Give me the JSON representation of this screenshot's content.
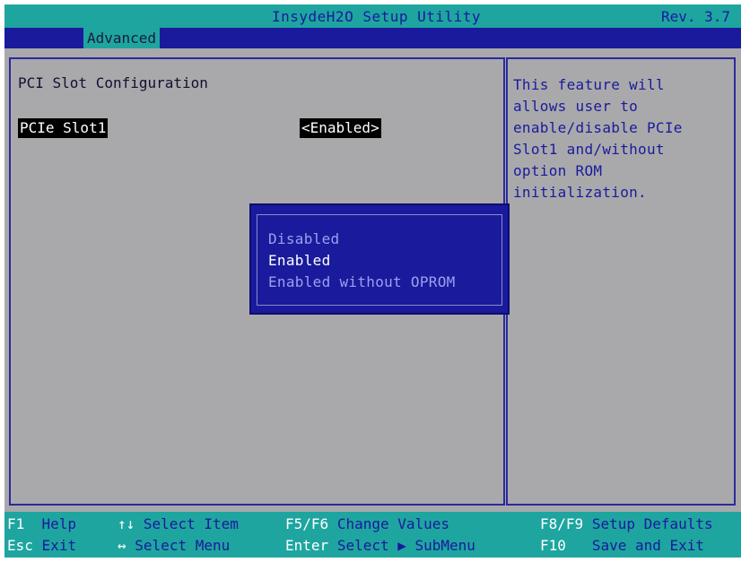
{
  "header": {
    "title": "InsydeH2O Setup Utility",
    "revision": "Rev. 3.7"
  },
  "menu": {
    "active_tab": "Advanced"
  },
  "main": {
    "section_title": "PCI Slot Configuration",
    "setting": {
      "label": "PCIe Slot1",
      "value": "<Enabled>"
    }
  },
  "help": {
    "lines": [
      "This feature will",
      "allows user to",
      "enable/disable PCIe",
      "Slot1 and/without",
      "option ROM",
      "initialization."
    ]
  },
  "popup": {
    "options": [
      "Disabled",
      "Enabled",
      "Enabled without OPROM"
    ],
    "selected": "Enabled"
  },
  "footer": {
    "f1_key": "F1",
    "f1_desc": "Help",
    "esc_key": "Esc",
    "esc_desc": "Exit",
    "updown_key": "↑↓",
    "updown_desc": "Select Item",
    "leftright_key": "↔",
    "leftright_desc": "Select Menu",
    "f5f6_key": "F5/F6",
    "f5f6_desc": "Change Values",
    "enter_key": "Enter",
    "enter_desc": "Select ▶ SubMenu",
    "f8f9_key": "F8/F9",
    "f8f9_desc": "Setup Defaults",
    "f10_key": "F10",
    "f10_desc": "Save and Exit"
  },
  "colors": {
    "teal": "#1ea5a0",
    "blue": "#1a1a9c",
    "gray": "#a9a9ab"
  }
}
